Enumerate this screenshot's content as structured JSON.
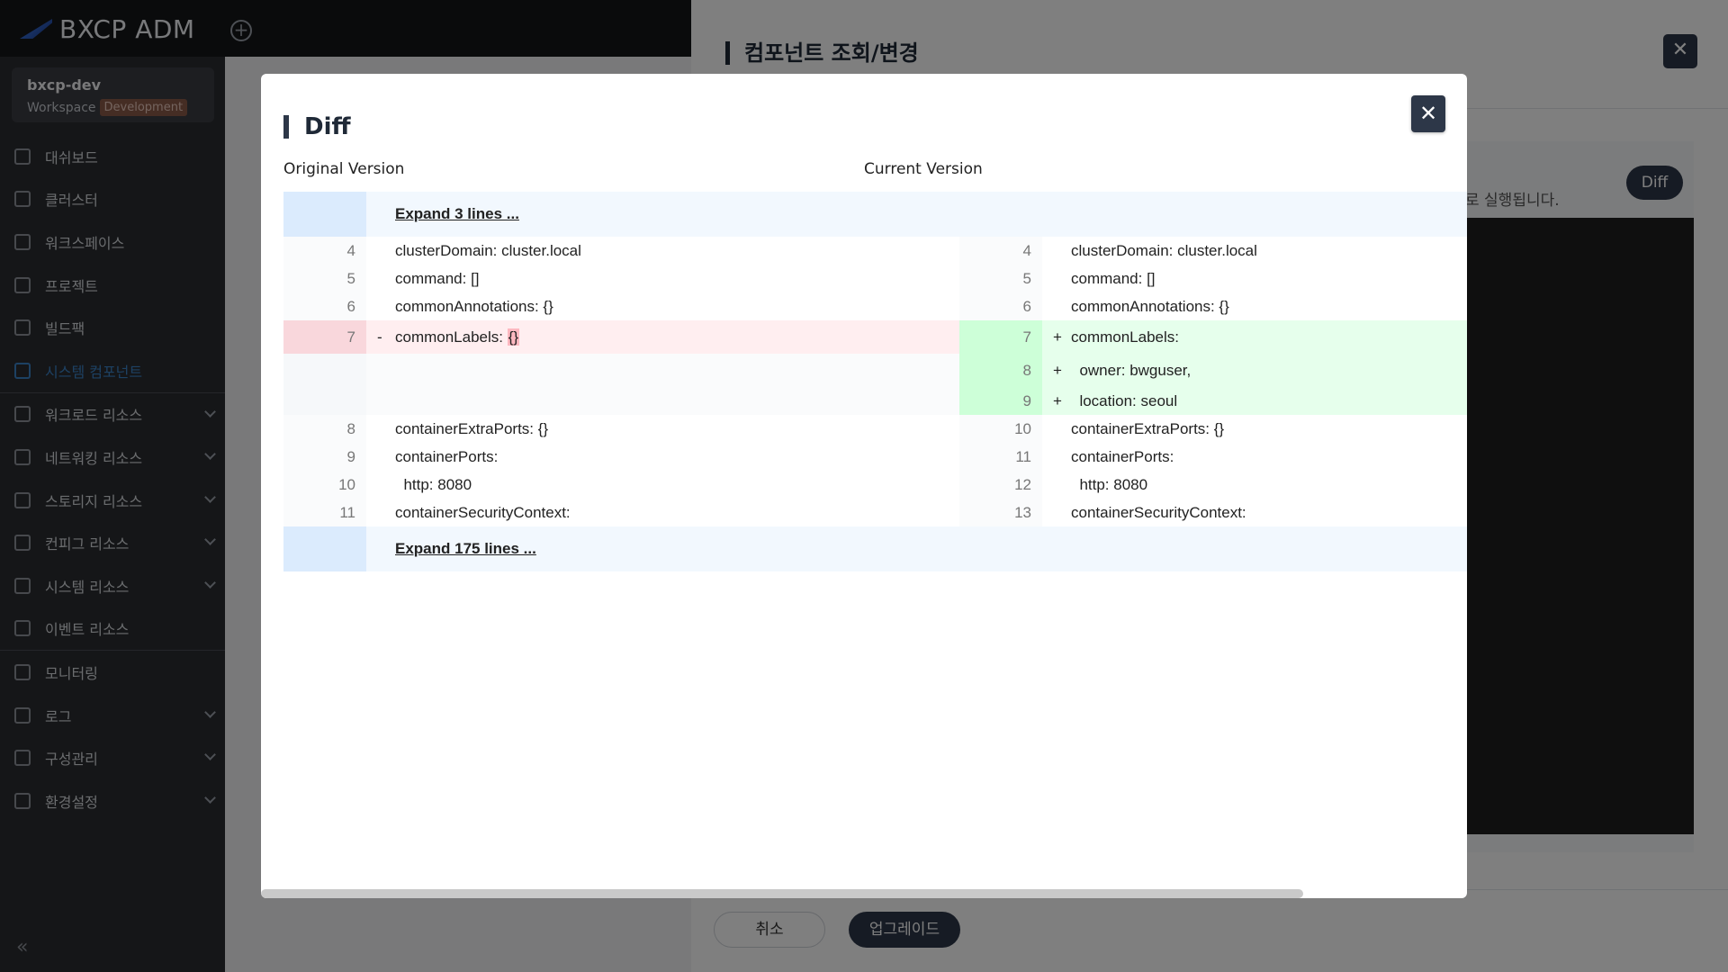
{
  "app": {
    "logo_text": "BXCP ADM"
  },
  "workspace": {
    "name": "bxcp-dev",
    "label": "Workspace",
    "badge": "Development"
  },
  "nav": [
    {
      "label": "대쉬보드",
      "icon": "dashboard-icon"
    },
    {
      "label": "클러스터",
      "icon": "cluster-icon"
    },
    {
      "label": "워크스페이스",
      "icon": "workspace-icon"
    },
    {
      "label": "프로젝트",
      "icon": "project-icon"
    },
    {
      "label": "빌드팩",
      "icon": "buildpack-icon"
    },
    {
      "label": "시스템 컴포넌트",
      "icon": "system-component-icon",
      "active": true
    },
    {
      "label": "워크로드 리소스",
      "icon": "workload-icon",
      "expandable": true
    },
    {
      "label": "네트워킹 리소스",
      "icon": "network-icon",
      "expandable": true
    },
    {
      "label": "스토리지 리소스",
      "icon": "storage-icon",
      "expandable": true
    },
    {
      "label": "컨피그 리소스",
      "icon": "config-icon",
      "expandable": true
    },
    {
      "label": "시스템 리소스",
      "icon": "system-resource-icon",
      "expandable": true
    },
    {
      "label": "이벤트 리소스",
      "icon": "event-icon"
    },
    {
      "label": "모니터링",
      "icon": "monitoring-icon"
    },
    {
      "label": "로그",
      "icon": "log-icon",
      "expandable": true
    },
    {
      "label": "구성관리",
      "icon": "configuration-icon",
      "expandable": true
    },
    {
      "label": "환경설정",
      "icon": "settings-icon",
      "expandable": true
    }
  ],
  "panel": {
    "title": "컴포넌트 조회/변경",
    "diff_label": "Diff",
    "note": "로 실행됩니다.",
    "cancel_label": "취소",
    "upgrade_label": "업그레이드"
  },
  "modal": {
    "title": "Diff",
    "original_label": "Original Version",
    "current_label": "Current Version",
    "expand_top": "Expand 3 lines ...",
    "expand_bottom": "Expand 175 lines ...",
    "context_before": [
      {
        "ln": "4",
        "rn": "4",
        "text": "clusterDomain: cluster.local"
      },
      {
        "ln": "5",
        "rn": "5",
        "text": "command: []"
      },
      {
        "ln": "6",
        "rn": "6",
        "text": "commonAnnotations: {}"
      }
    ],
    "removed": {
      "ln": "7",
      "marker": "-",
      "text": "commonLabels: ",
      "highlight": "{}"
    },
    "added": [
      {
        "rn": "7",
        "marker": "+",
        "text": "commonLabels:"
      },
      {
        "rn": "8",
        "marker": "+",
        "text": "  owner: bwguser,"
      },
      {
        "rn": "9",
        "marker": "+",
        "text": "  location: seoul"
      }
    ],
    "context_after": [
      {
        "ln": "8",
        "rn": "10",
        "text": "containerExtraPorts: {}"
      },
      {
        "ln": "9",
        "rn": "11",
        "text": "containerPorts:"
      },
      {
        "ln": "10",
        "rn": "12",
        "text": "  http: 8080"
      },
      {
        "ln": "11",
        "rn": "13",
        "text": "containerSecurityContext:"
      }
    ]
  },
  "colors": {
    "accent": "#2d3748",
    "active_nav": "#3b82c6",
    "deleted": "#ffeef0",
    "added": "#e6ffec"
  }
}
